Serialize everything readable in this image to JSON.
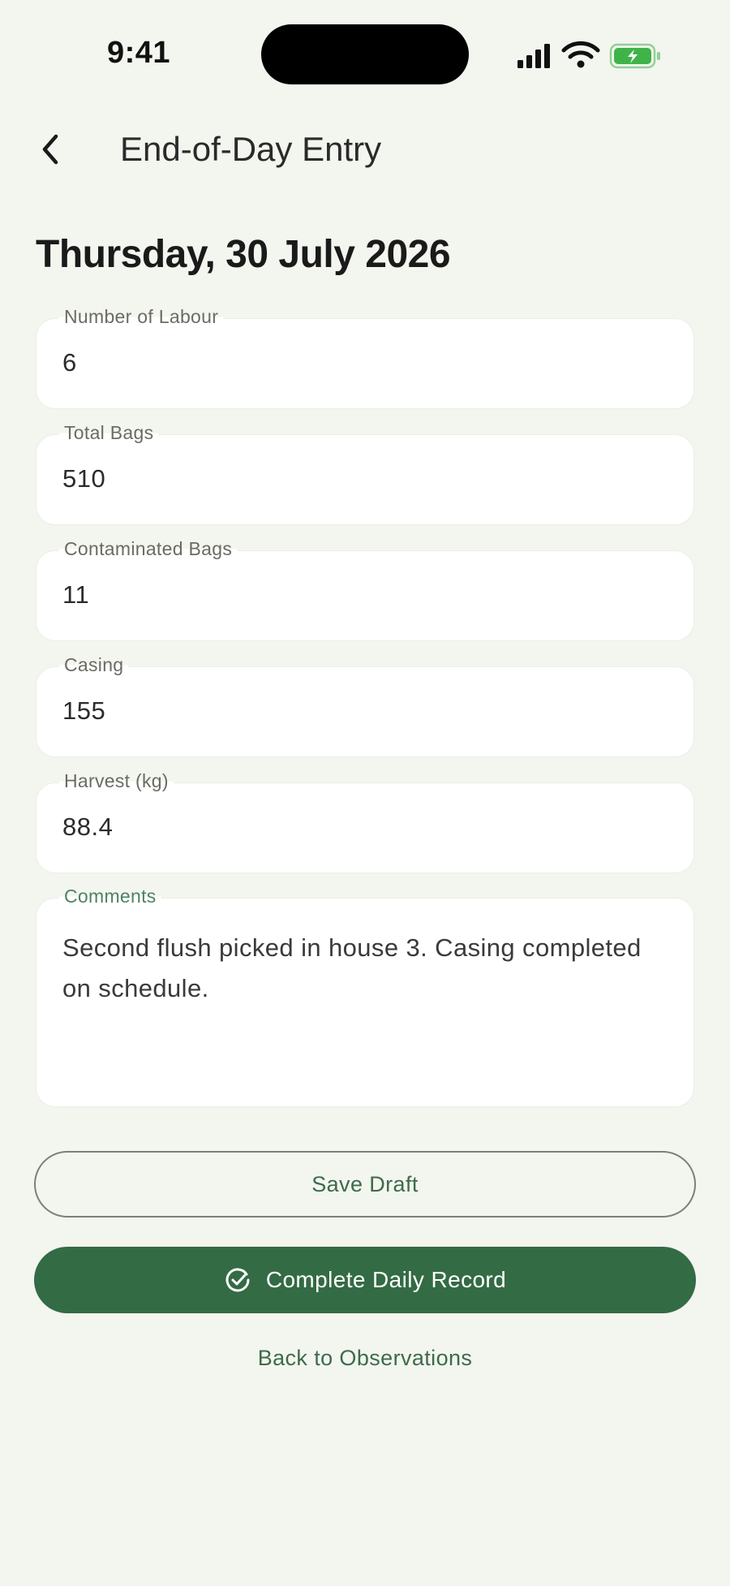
{
  "status_bar": {
    "time": "9:41"
  },
  "header": {
    "back_icon": "chevron-left-icon",
    "title": "End-of-Day Entry"
  },
  "date_heading": "Thursday, 30 July 2026",
  "fields": [
    {
      "label": "Number of Labour",
      "value": "6"
    },
    {
      "label": "Total Bags",
      "value": "510"
    },
    {
      "label": "Contaminated Bags",
      "value": "11"
    },
    {
      "label": "Casing",
      "value": "155"
    },
    {
      "label": "Harvest (kg)",
      "value": "88.4"
    }
  ],
  "comments": {
    "label": "Comments",
    "value": "Second flush picked in house 3. Casing completed on schedule."
  },
  "actions": {
    "save_draft": "Save Draft",
    "complete": "Complete Daily Record",
    "complete_icon": "check-circle-icon",
    "back_link": "Back to Observations"
  },
  "colors": {
    "background": "#f3f5ef",
    "primary": "#336b44",
    "accent_text": "#3d6b4b",
    "battery": "#3fb34a"
  }
}
